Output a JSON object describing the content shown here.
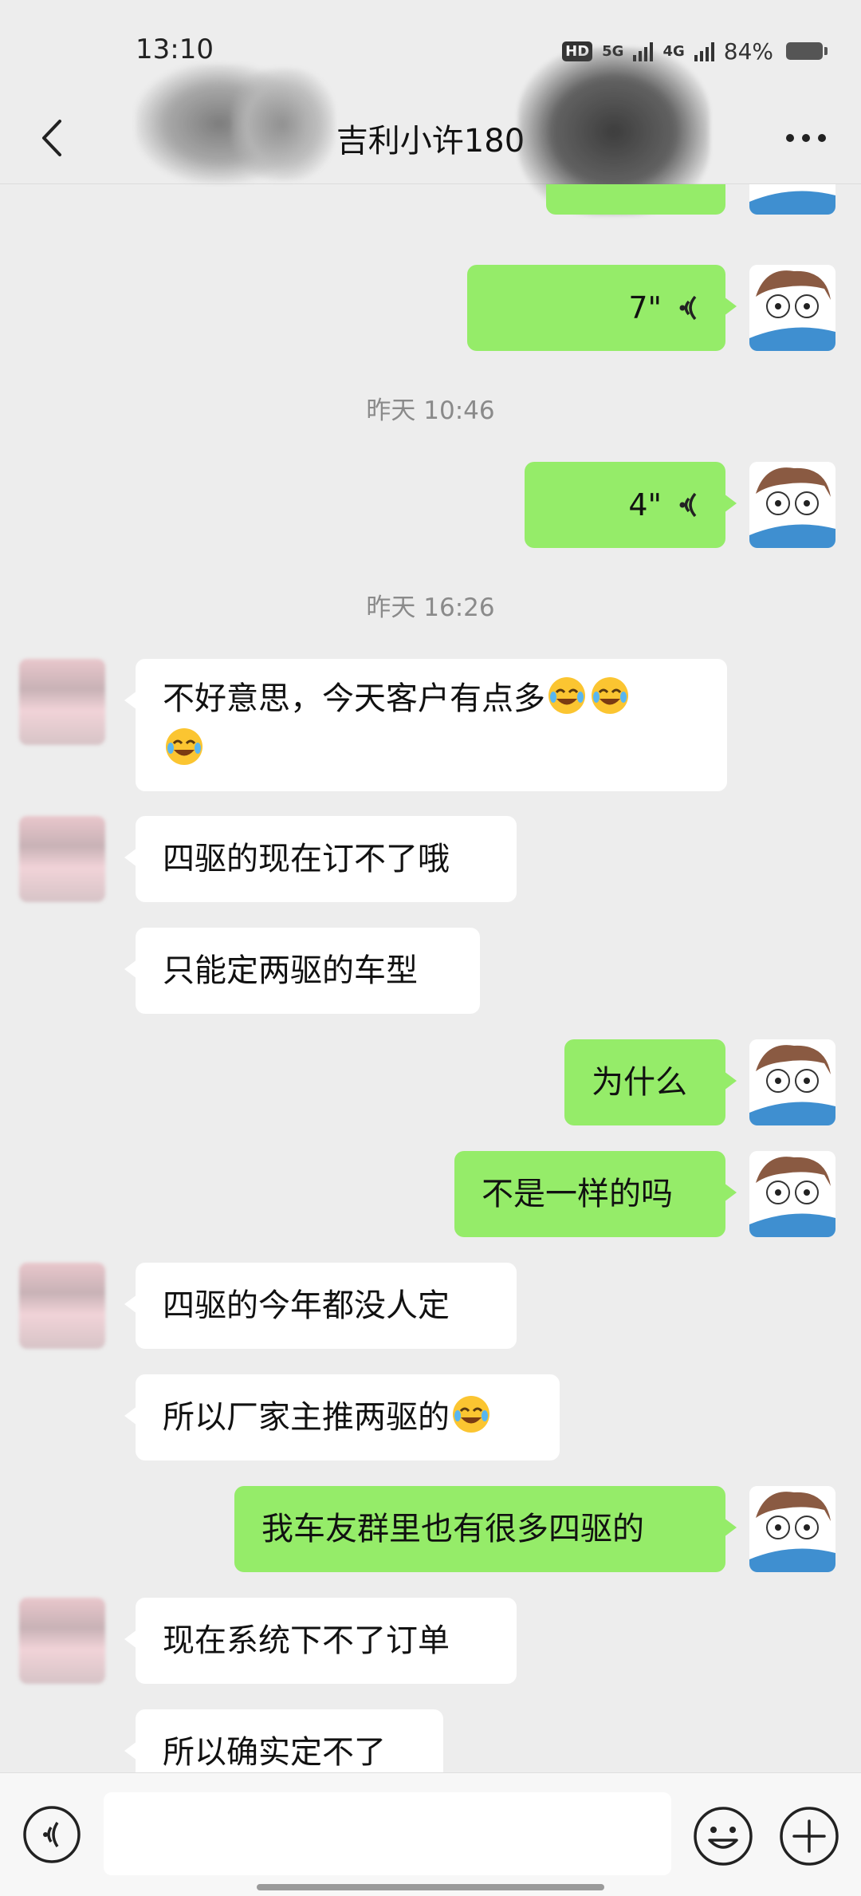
{
  "status_bar": {
    "time": "13:10",
    "hd_label": "HD",
    "network_5g": "5G",
    "network_4g": "4G",
    "battery": "84%"
  },
  "header": {
    "title": "吉利小许180"
  },
  "messages": [
    {
      "kind": "voice",
      "side": "self",
      "duration": "7\""
    },
    {
      "kind": "time",
      "text": "昨天 10:46"
    },
    {
      "kind": "voice",
      "side": "self",
      "duration": "4\""
    },
    {
      "kind": "time",
      "text": "昨天 16:26"
    },
    {
      "kind": "text",
      "side": "other",
      "line1": "不好意思，今天客户有点多",
      "emoji": "tears-of-joy-emoji"
    },
    {
      "kind": "text",
      "side": "other",
      "text": "四驱的现在订不了哦"
    },
    {
      "kind": "text",
      "side": "other",
      "text": "只能定两驱的车型"
    },
    {
      "kind": "text",
      "side": "self",
      "text": "为什么"
    },
    {
      "kind": "text",
      "side": "self",
      "text": "不是一样的吗"
    },
    {
      "kind": "text",
      "side": "other",
      "text": "四驱的今年都没人定"
    },
    {
      "kind": "text",
      "side": "other",
      "text": "所以厂家主推两驱的",
      "emoji": "tears-of-joy-emoji"
    },
    {
      "kind": "text",
      "side": "self",
      "text": "我车友群里也有很多四驱的"
    },
    {
      "kind": "text",
      "side": "other",
      "text": "现在系统下不了订单"
    },
    {
      "kind": "text",
      "side": "other",
      "text": "所以确实定不了"
    }
  ],
  "input": {
    "value": "",
    "placeholder": ""
  },
  "icons": {
    "back": "chevron-left-icon",
    "more": "more-dots-icon",
    "voice": "voice-wave-icon",
    "emoji": "smile-icon",
    "plus": "plus-circle-icon"
  },
  "colors": {
    "self_bubble": "#95ec69",
    "other_bubble": "#ffffff",
    "background": "#ededed"
  }
}
